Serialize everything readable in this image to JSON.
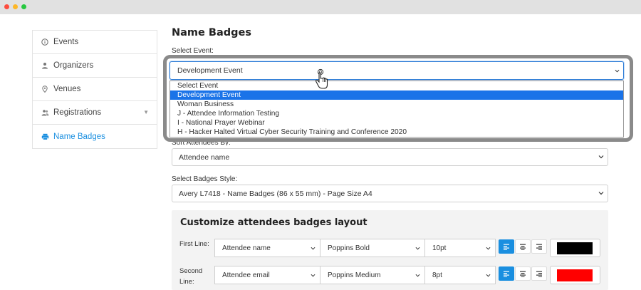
{
  "window": {
    "controls": [
      "close",
      "minimize",
      "maximize"
    ]
  },
  "sidebar": {
    "items": [
      {
        "label": "Events",
        "icon": "info-circle-icon",
        "active": false
      },
      {
        "label": "Organizers",
        "icon": "user-icon",
        "active": false
      },
      {
        "label": "Venues",
        "icon": "map-pin-icon",
        "active": false
      },
      {
        "label": "Registrations",
        "icon": "users-icon",
        "active": false,
        "has_caret": true
      },
      {
        "label": "Name Badges",
        "icon": "printer-icon",
        "active": true
      }
    ]
  },
  "main": {
    "title": "Name Badges",
    "select_event": {
      "label": "Select Event:",
      "value": "Development Event",
      "options": [
        "Select Event",
        "Development Event",
        "Woman Business",
        "J - Attendee Information Testing",
        "I - National Prayer Webinar",
        "H - Hacker Halted Virtual Cyber Security Training and Conference 2020"
      ],
      "selected_index": 1
    },
    "sort_attendees": {
      "label": "Sort Attendees By:",
      "value": "Attendee name"
    },
    "badges_style": {
      "label": "Select Badges Style:",
      "value": "Avery L7418 - Name Badges (86 x 55 mm) - Page Size A4"
    },
    "customize": {
      "title": "Customize attendees badges layout",
      "rows": [
        {
          "label_line1": "First Line:",
          "label_line2": "",
          "field": "Attendee name",
          "font": "Poppins Bold",
          "size": "10pt",
          "align": "left",
          "color": "#000000"
        },
        {
          "label_line1": "Second",
          "label_line2": "Line:",
          "field": "Attendee email",
          "font": "Poppins Medium",
          "size": "8pt",
          "align": "left",
          "color": "#ff0000"
        }
      ]
    }
  },
  "colors": {
    "accent": "#1a8fe0",
    "option_selected": "#1a73e8",
    "highlight_frame": "#8a8a8a"
  }
}
